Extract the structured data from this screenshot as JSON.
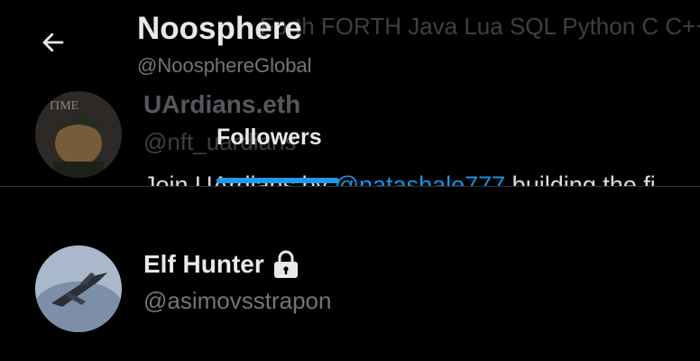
{
  "header": {
    "title": "Noosphere",
    "handle": "@NoosphereGlobal",
    "tab_label": "Followers"
  },
  "scrolled_text": "Forth FORTH Java Lua SQL Python C C++",
  "users": [
    {
      "name": "UArdians.eth",
      "handle": "@nft_uardians",
      "bio_prefix": "Join UArdians by ",
      "bio_mention": "@natashale777",
      "bio_suffix": " building the fi",
      "avatar_icon": "doge-avatar-image"
    },
    {
      "name": "Elf Hunter",
      "handle": "@asimovsstrapon",
      "protected_icon": "lock-icon",
      "avatar_icon": "spaceship-avatar-image"
    }
  ],
  "colors": {
    "accent": "#1d9bf0",
    "background": "#000000",
    "secondary_text": "#71767b"
  }
}
